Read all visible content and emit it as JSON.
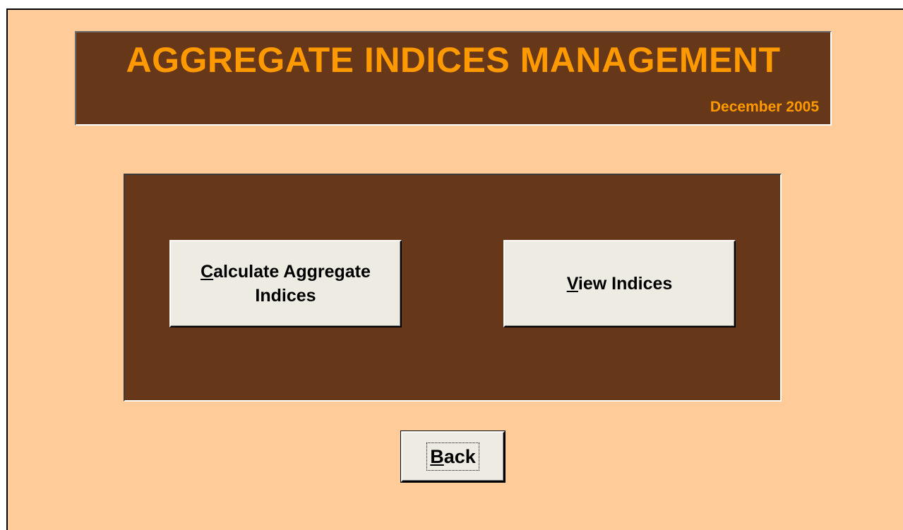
{
  "header": {
    "title": "AGGREGATE INDICES MANAGEMENT",
    "date": "December 2005"
  },
  "buttons": {
    "calculate": {
      "mnemonic": "C",
      "line1_rest": "alculate Aggregate",
      "line2": "Indices"
    },
    "view": {
      "mnemonic": "V",
      "rest": "iew Indices"
    },
    "back": {
      "mnemonic": "B",
      "rest": "ack"
    }
  },
  "colors": {
    "form_background": "#ffcc99",
    "panel_brown": "#663719",
    "title_orange": "#ff9900",
    "button_face": "#eeebe2"
  }
}
